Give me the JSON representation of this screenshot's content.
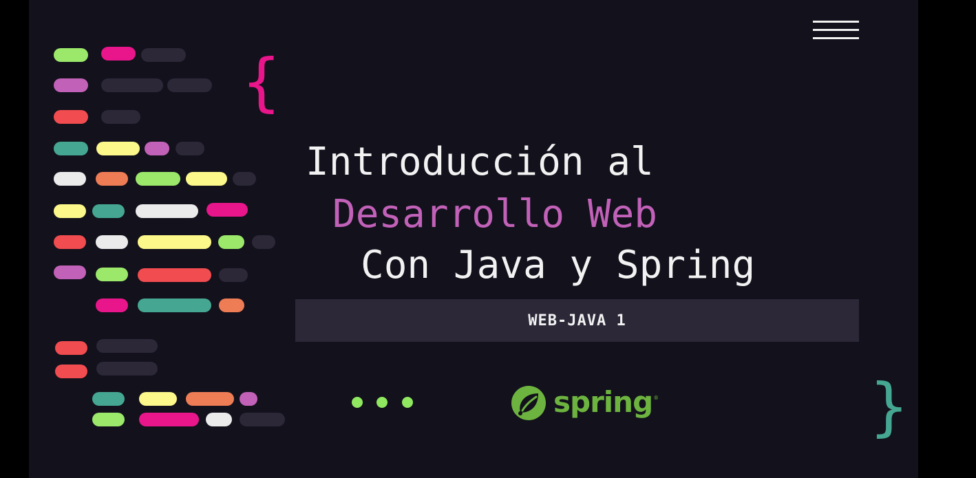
{
  "title": {
    "line1": "Introducción al",
    "line2": "Desarrollo Web",
    "line3": "Con Java y Spring"
  },
  "badge": {
    "label": "WEB-JAVA 1"
  },
  "braces": {
    "open": "{",
    "close": "}"
  },
  "logo": {
    "wordmark": "spring",
    "registered": "®",
    "icon": "spring-leaf-icon"
  },
  "menu": {
    "icon": "hamburger-menu-icon"
  },
  "colors": {
    "background": "#12111c",
    "title_primary": "#f2f2f2",
    "title_accent": "#c261b8",
    "badge_bg": "#2c2838",
    "brace_open": "#e8168a",
    "brace_close": "#45a791",
    "dots": "#8fe860",
    "spring_green": "#6db33f"
  }
}
